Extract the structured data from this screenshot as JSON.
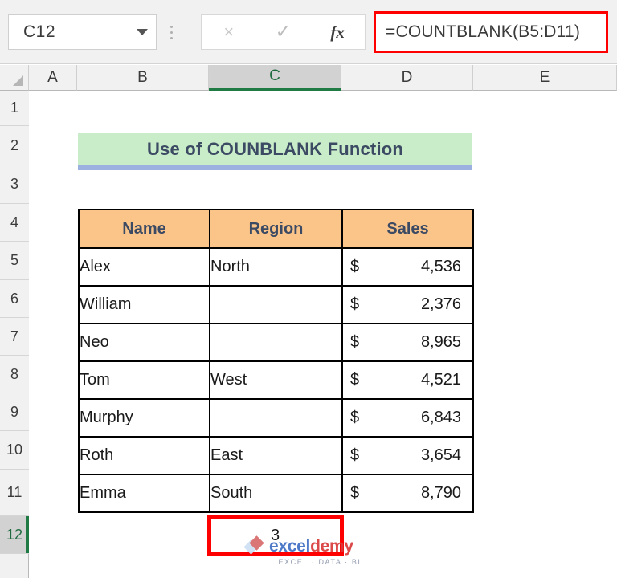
{
  "formula_bar": {
    "name_box_value": "C12",
    "name_box_dropdown_icon": "chevron-down-icon",
    "cancel_icon": "×",
    "confirm_icon": "✓",
    "function_icon": "fx",
    "formula_value": "=COUNTBLANK(B5:D11)",
    "highlight_color": "#ff0000"
  },
  "grid": {
    "select_all_icon": "select-all-triangle-icon",
    "columns": [
      "A",
      "B",
      "C",
      "D",
      "E"
    ],
    "selected_column": "C",
    "rows": [
      "1",
      "2",
      "3",
      "4",
      "5",
      "6",
      "7",
      "8",
      "9",
      "10",
      "11",
      "12"
    ],
    "selected_row": "12",
    "selection_color": "#1f7a43"
  },
  "title_banner": {
    "text": "Use of COUNBLANK Function",
    "fill_color": "#c8edc8",
    "underline_color": "#9db1e0"
  },
  "table": {
    "header_fill": "#fbc58a",
    "header_text_color": "#3c4a63",
    "headers": [
      "Name",
      "Region",
      "Sales"
    ],
    "rows": [
      {
        "name": "Alex",
        "region": "North",
        "currency": "$",
        "sales": "4,536"
      },
      {
        "name": "William",
        "region": "",
        "currency": "$",
        "sales": "2,376"
      },
      {
        "name": "Neo",
        "region": "",
        "currency": "$",
        "sales": "8,965"
      },
      {
        "name": "Tom",
        "region": "West",
        "currency": "$",
        "sales": "4,521"
      },
      {
        "name": "Murphy",
        "region": "",
        "currency": "$",
        "sales": "6,843"
      },
      {
        "name": "Roth",
        "region": "East",
        "currency": "$",
        "sales": "3,654"
      },
      {
        "name": "Emma",
        "region": "South",
        "currency": "$",
        "sales": "8,790"
      }
    ]
  },
  "result": {
    "value": "3",
    "highlight_color": "#ff0000"
  },
  "watermark": {
    "brand_part1": "excel",
    "brand_part2": "demy",
    "tagline": "EXCEL  ·  DATA  ·  BI"
  }
}
